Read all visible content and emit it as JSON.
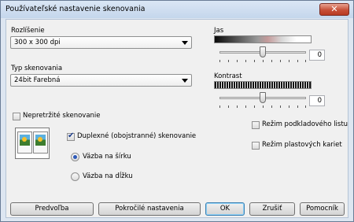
{
  "window": {
    "title": "Používateľské nastavenie skenovania",
    "close_icon": "close-icon",
    "accent": "#c75038"
  },
  "resolution": {
    "label": "Rozlíšenie",
    "selected": "300 x 300 dpi"
  },
  "scan_type": {
    "label": "Typ skenovania",
    "selected": "24bit Farebná"
  },
  "brightness": {
    "label": "Jas",
    "value": "0",
    "level": 0.5
  },
  "contrast": {
    "label": "Kontrast",
    "value": "0",
    "level": 0.5
  },
  "continuous_scan": {
    "label": "Nepretržité skenovanie",
    "checked": false
  },
  "duplex": {
    "icon": "duplex-document-icon",
    "label": "Duplexné (obojstranné) skenovanie",
    "checked": true,
    "options": [
      {
        "label": "Väzba na šírku",
        "selected": true
      },
      {
        "label": "Väzba na dĺžku",
        "selected": false
      }
    ]
  },
  "carrier_sheet": {
    "label": "Režim podkladového listu",
    "checked": false
  },
  "plastic_card": {
    "label": "Režim plastových kariet",
    "checked": false
  },
  "buttons": {
    "preset": "Predvoľba",
    "advanced": "Pokročilé nastavenia",
    "ok": "OK",
    "cancel": "Zrušiť",
    "help": "Pomocník"
  }
}
